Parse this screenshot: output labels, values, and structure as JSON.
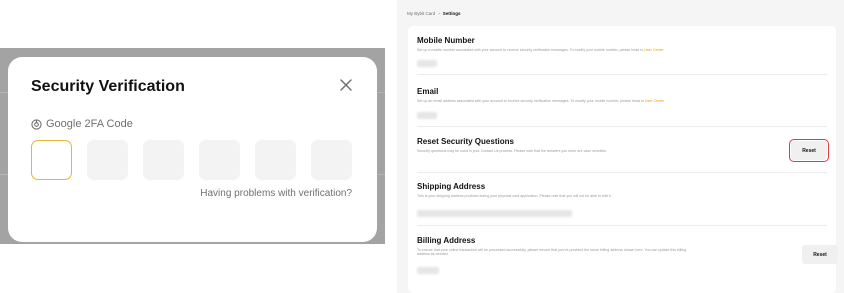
{
  "modal": {
    "title": "Security Verification",
    "method_label": "Google 2FA Code",
    "code_digits": [
      "",
      "",
      "",
      "",
      "",
      ""
    ],
    "help_link": "Having problems with verification?"
  },
  "settings": {
    "breadcrumb": {
      "parent": "My Bybit Card",
      "separator": "›",
      "current": "Settings"
    },
    "sections": {
      "mobile": {
        "title": "Mobile Number",
        "desc": "Set up a mobile number associated with your account to receive security verification messages. To modify your mobile number, please head to",
        "link": "User Center"
      },
      "email": {
        "title": "Email",
        "desc": "Set up an email address associated with your account to receive security verification messages. To modify your mobile number, please head to",
        "link": "User Center"
      },
      "security_questions": {
        "title": "Reset Security Questions",
        "desc": "Security questions may be used in your Contact Us process. Please note that the answers you enter are case sensitive.",
        "button": "Reset"
      },
      "shipping": {
        "title": "Shipping Address",
        "desc": "This is your shipping address provided during your physical card application. Please note that you will not be able to edit it."
      },
      "billing": {
        "title": "Billing Address",
        "desc_line1": "To ensure that your online transaction will be processed successfully, please ensure that you've provided the same billing address shown here. You can update this billing",
        "desc_line2": "address as needed.",
        "button": "Reset"
      }
    }
  },
  "colors": {
    "accent": "#e8b53c",
    "link": "#e8a000",
    "highlight_outline": "#e0393e"
  }
}
